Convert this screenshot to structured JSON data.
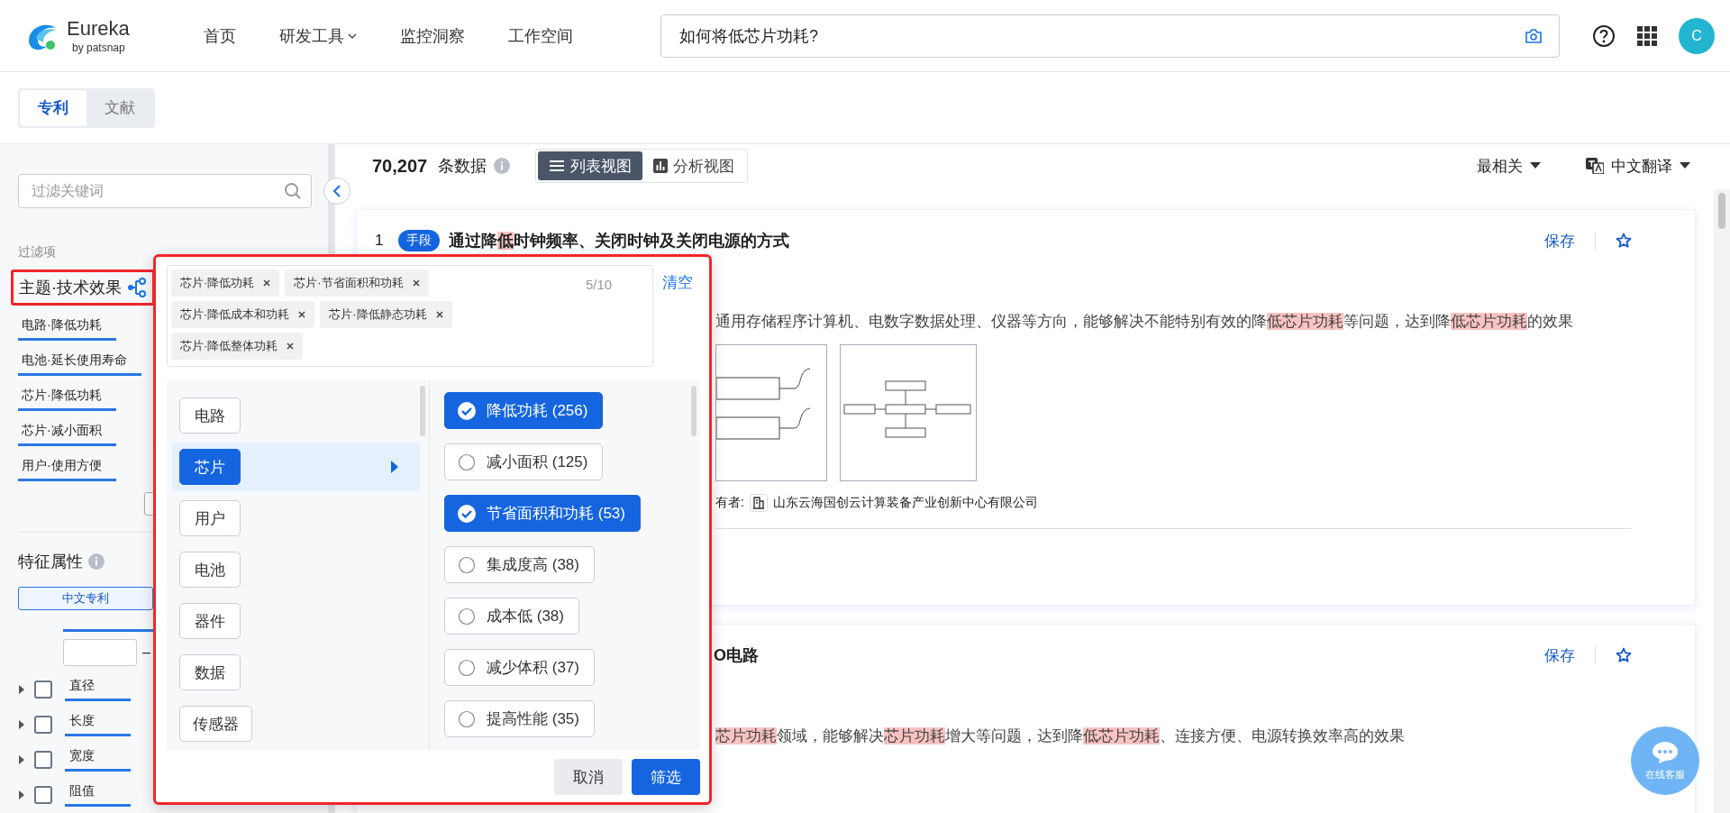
{
  "header": {
    "logo": {
      "name": "Eureka",
      "tagline": "by patsnap"
    },
    "nav": [
      {
        "label": "首页",
        "dropdown": false
      },
      {
        "label": "研发工具",
        "dropdown": true
      },
      {
        "label": "监控洞察",
        "dropdown": false
      },
      {
        "label": "工作空间",
        "dropdown": false
      }
    ],
    "search": {
      "value": "如何将低芯片功耗?"
    },
    "avatar": "C"
  },
  "source_tabs": [
    {
      "label": "专利",
      "selected": true
    },
    {
      "label": "文献",
      "selected": false
    }
  ],
  "sidebar": {
    "filter_search": {
      "placeholder": "过滤关键词"
    },
    "section_label": "过滤项",
    "topic": {
      "title": "主题·技术效果",
      "items": [
        {
          "label": "电路·降低功耗"
        },
        {
          "label": "电池·延长使用寿命"
        },
        {
          "label": "芯片·降低功耗"
        },
        {
          "label": "芯片·减小面积"
        },
        {
          "label": "用户·使用方便"
        }
      ]
    },
    "features": {
      "title": "特征属性",
      "tabs": [
        {
          "label": "中文专利",
          "selected": true
        }
      ],
      "range_separator": "–",
      "rows": [
        {
          "label": "直径",
          "checked": false
        },
        {
          "label": "长度",
          "checked": false
        },
        {
          "label": "宽度",
          "checked": false
        },
        {
          "label": "阻值",
          "checked": false
        }
      ]
    }
  },
  "results": {
    "count": "70,207",
    "count_unit": "条数据",
    "views": [
      {
        "label": "列表视图",
        "selected": true,
        "kind": "list"
      },
      {
        "label": "分析视图",
        "selected": false,
        "kind": "chart"
      }
    ],
    "sort": "最相关",
    "translate": "中文翻译",
    "cards": [
      {
        "index": "1",
        "badge": "手段",
        "title": [
          {
            "text": "通过降",
            "highlight": false
          },
          {
            "text": "低",
            "highlight": true
          },
          {
            "text": "时钟频率、关闭时钟及关闭电源的方式",
            "highlight": false
          }
        ],
        "summary": [
          {
            "text": "通用存储程序计算机、电数字数据处理、仪器等方向，能够解决不能特别有效的降",
            "highlight": false
          },
          {
            "text": "低芯片功耗",
            "highlight": true
          },
          {
            "text": "等问题，达到降",
            "highlight": false
          },
          {
            "text": "低芯片功耗",
            "highlight": true
          },
          {
            "text": "的效果",
            "highlight": false
          }
        ],
        "figures": [
          {
            "kind": "block"
          },
          {
            "kind": "flow"
          }
        ],
        "owner": {
          "label": "有者:",
          "name": "山东云海国创云计算装备产业创新中心有限公司"
        },
        "save": "保存"
      },
      {
        "title": [
          {
            "text": "O电路",
            "highlight": false
          }
        ],
        "summary": [
          {
            "text": "芯片功耗",
            "highlight": true
          },
          {
            "text": "领域，能够解决",
            "highlight": false
          },
          {
            "text": "芯片功耗",
            "highlight": true
          },
          {
            "text": "增大等问题，达到降",
            "highlight": false
          },
          {
            "text": "低芯片功耗",
            "highlight": true
          },
          {
            "text": "、连接方便、电源转换效率高的效果",
            "highlight": false
          }
        ],
        "save": "保存"
      }
    ]
  },
  "popup": {
    "tags": [
      "芯片·降低功耗",
      "芯片·节省面积和功耗",
      "芯片·降低成本和功耗",
      "芯片·降低静态功耗",
      "芯片·降低整体功耗"
    ],
    "counter": "5/10",
    "clear": "清空",
    "categories": [
      {
        "label": "电路",
        "selected": false
      },
      {
        "label": "芯片",
        "selected": true
      },
      {
        "label": "用户",
        "selected": false
      },
      {
        "label": "电池",
        "selected": false
      },
      {
        "label": "器件",
        "selected": false
      },
      {
        "label": "数据",
        "selected": false
      },
      {
        "label": "传感器",
        "selected": false
      }
    ],
    "options": [
      {
        "label": "降低功耗 (256)",
        "checked": true
      },
      {
        "label": "减小面积 (125)",
        "checked": false
      },
      {
        "label": "节省面积和功耗 (53)",
        "checked": true
      },
      {
        "label": "集成度高 (38)",
        "checked": false
      },
      {
        "label": "成本低 (38)",
        "checked": false
      },
      {
        "label": "减少体积 (37)",
        "checked": false
      },
      {
        "label": "提高性能 (35)",
        "checked": false
      }
    ],
    "cancel": "取消",
    "confirm": "筛选"
  },
  "chat": {
    "label": "在线客服"
  }
}
